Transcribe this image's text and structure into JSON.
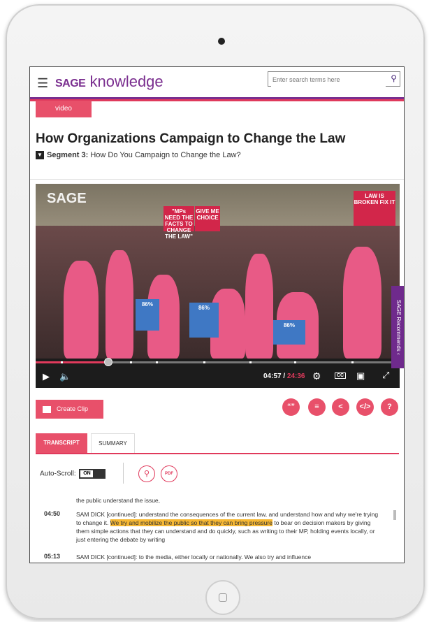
{
  "header": {
    "logo_sage": "SAGE",
    "logo_knowledge": "knowledge",
    "search_placeholder": "Enter search terms here"
  },
  "content": {
    "tag": "video",
    "title": "How Organizations Campaign to Change the Law",
    "segment_label": "Segment 3:",
    "segment_title": "How Do You Campaign to Change the Law?"
  },
  "player": {
    "watermark": "SAGE",
    "current_time": "04:57",
    "separator": " / ",
    "duration": "24:36",
    "cc_label": "CC",
    "progress_fraction": 0.2,
    "signs": [
      "\"MPs NEED THE FACTS TO CHANGE THE LAW\"",
      "GIVE ME CHOICE",
      "LAW IS BROKEN FIX IT",
      "86%",
      "86%",
      "86%"
    ]
  },
  "sidebar": {
    "recommends_label": "SAGE Recommends"
  },
  "actions": {
    "create_clip": "Create Clip",
    "cite_icon": "quote-icon",
    "list_icon": "list-icon",
    "share_icon": "share-icon",
    "embed_icon": "code-icon",
    "help_label": "?"
  },
  "tabs": {
    "transcript": "TRANSCRIPT",
    "summary": "SUMMARY"
  },
  "transcript_controls": {
    "autoscroll_label": "Auto-Scroll:",
    "toggle_state": "ON",
    "pdf_label": "PDF"
  },
  "transcript": {
    "partial_top": "the public understand the issue,",
    "entries": [
      {
        "time": "04:50",
        "before": "SAM DICK [continued]: understand the consequences of the current law, and understand how and why we're trying to change it. ",
        "highlight": "We try and mobilize the public so that they can bring pressure",
        "after": " to bear on decision makers by giving them simple actions that they can understand and do quickly, such as writing to their MP, holding events locally, or just entering the debate by writing"
      },
      {
        "time": "05:13",
        "before": "SAM DICK [continued]: to the media, either locally or nationally. We also try and influence",
        "highlight": "",
        "after": ""
      }
    ]
  }
}
